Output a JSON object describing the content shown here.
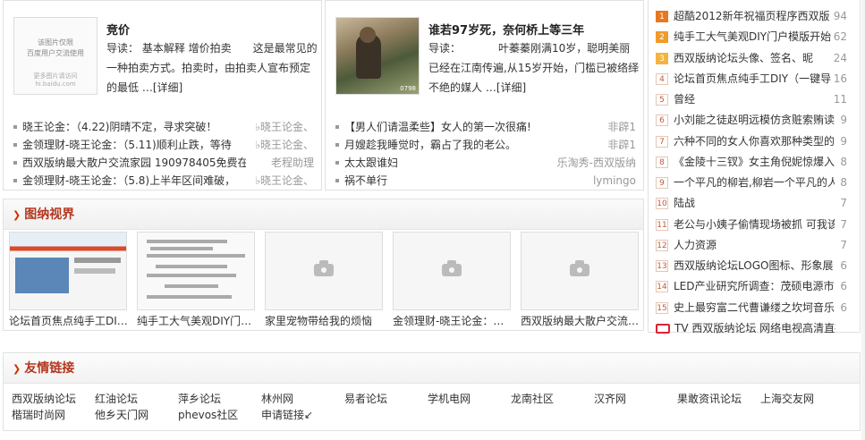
{
  "feature_left": {
    "thumb_text_1": "该图片仅限",
    "thumb_text_2": "百度用户交流使用",
    "thumb_footer_1": "更多图片请访问",
    "thumb_footer_2": "hi.baidu.com",
    "title": "竞价",
    "body": "导读： 基本解释 增价拍卖　　这是最常见的一种拍卖方式。拍卖时，由拍卖人宣布预定的最低 …",
    "detail_label": "[详细]"
  },
  "list_left": [
    {
      "title": "晓王论金：（4.22)阴晴不定，寻求突破！",
      "author": "♭晓王论金、"
    },
    {
      "title": "金领理财-晓王论金：（5.11)顺利止跌，等待",
      "author": "♭晓王论金、"
    },
    {
      "title": "西双版纳最大散户交流家园 190978405免费在",
      "author": "老程助理"
    },
    {
      "title": "金领理财-晓王论金：（5.8)上半年区间难破，",
      "author": "♭晓王论金、"
    }
  ],
  "feature_mid": {
    "thumb_watermark": "0798",
    "title": "谁若97岁死，奈何桥上等三年",
    "body": "导读：　　　　叶蓁蓁刚满10岁，聪明美丽已经在江南传遍,从15岁开始，门槛已被络绎不绝的媒人 …",
    "detail_label": "[详细]"
  },
  "list_mid": [
    {
      "title": "【男人们请温柔些】女人的第一次很痛!",
      "author": "非辟1"
    },
    {
      "title": "月嫂趁我睡觉时，霸占了我的老公。",
      "author": "非辟1"
    },
    {
      "title": "太太跟谁妇",
      "author": "乐淘秀-西双版纳"
    },
    {
      "title": "祸不单行",
      "author": "lymingo"
    }
  ],
  "picture_section": {
    "heading": "图纳视界",
    "items": [
      {
        "caption": "论坛首页焦点纯手工DI…",
        "kind": "screenshot-1"
      },
      {
        "caption": "纯手工大气美观DIY门…",
        "kind": "screenshot-2"
      },
      {
        "caption": "家里宠物带给我的烦恼",
        "kind": "placeholder"
      },
      {
        "caption": "金领理财-晓王论金：…",
        "kind": "placeholder"
      },
      {
        "caption": "西双版纳最大散户交流…",
        "kind": "placeholder"
      }
    ]
  },
  "hot_list": [
    {
      "rank": "1",
      "title": "超酷2012新年祝福页程序西双版",
      "count": "94"
    },
    {
      "rank": "2",
      "title": "纯手工大气美观DIY门户模版开始",
      "count": "62"
    },
    {
      "rank": "3",
      "title": "西双版纳论坛头像、签名、昵",
      "count": "24"
    },
    {
      "rank": "4",
      "title": "论坛首页焦点纯手工DIY（一键导",
      "count": "16"
    },
    {
      "rank": "5",
      "title": "曾经",
      "count": "11"
    },
    {
      "rank": "6",
      "title": "小刘能之徒赵明远模仿贪赃索贿读",
      "count": "9"
    },
    {
      "rank": "7",
      "title": "六种不同的女人你喜欢那种类型的",
      "count": "9"
    },
    {
      "rank": "8",
      "title": "《金陵十三钗》女主角倪妮惊爆入",
      "count": "8"
    },
    {
      "rank": "9",
      "title": "一个平凡的柳岩,柳岩一个平凡的人",
      "count": "8"
    },
    {
      "rank": "10",
      "title": "陆战",
      "count": "7"
    },
    {
      "rank": "11",
      "title": "老公与小姨子偷情现场被抓 可我该",
      "count": "7"
    },
    {
      "rank": "12",
      "title": "人力资源",
      "count": "7"
    },
    {
      "rank": "13",
      "title": "西双版纳论坛LOGO图标、形象展",
      "count": "6"
    },
    {
      "rank": "14",
      "title": "LED产业研究所调查：茂硕电源市",
      "count": "6"
    },
    {
      "rank": "15",
      "title": "史上最穷富二代曹谦缕之坎坷音乐",
      "count": "6"
    },
    {
      "rank": "",
      "title": "TV 西双版纳论坛 网络电视高清直播",
      "count": ""
    }
  ],
  "friends": {
    "heading": "友情链接",
    "links": [
      "西双版纳论坛",
      "红油论坛",
      "萍乡论坛",
      "林州网",
      "易者论坛",
      "学机电网",
      "龙南社区",
      "汉齐网",
      "果敢资讯论坛",
      "上海交友网",
      "楷瑞时尚网",
      "他乡天门网",
      "phevos社区",
      "申请链接↙"
    ]
  },
  "colors": {
    "accent": "#b2371f",
    "rank_top": "#e8781e",
    "border": "#e1e1e1"
  }
}
